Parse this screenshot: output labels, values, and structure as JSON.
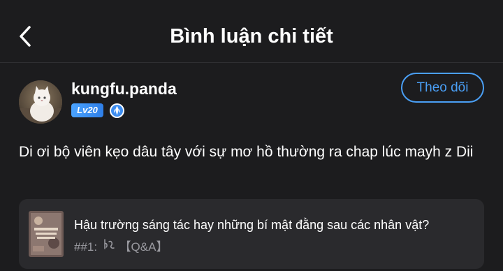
{
  "header": {
    "title": "Bình luận chi tiết",
    "back_icon": "chevron-left-icon"
  },
  "user": {
    "name": "kungfu.panda",
    "level": "Lv20",
    "follow_label": "Theo dõi",
    "level_icon": "rank-badge-icon"
  },
  "comment": {
    "text": "Di ơi bộ viên kẹo dâu tây với sự mơ hồ thường ra chap lúc mayh z Dii"
  },
  "reference": {
    "title": "Hậu trường sáng tác hay những bí mật đằng sau các nhân vật?",
    "chapter_prefix": "##1:",
    "chapter_suffix": "【Q&A】",
    "chapter_icon": "glyph-icon"
  },
  "colors": {
    "background": "#1c1c1e",
    "card": "#2a2a2d",
    "accent": "#4a9ff5",
    "muted_text": "#9a9aa0"
  }
}
